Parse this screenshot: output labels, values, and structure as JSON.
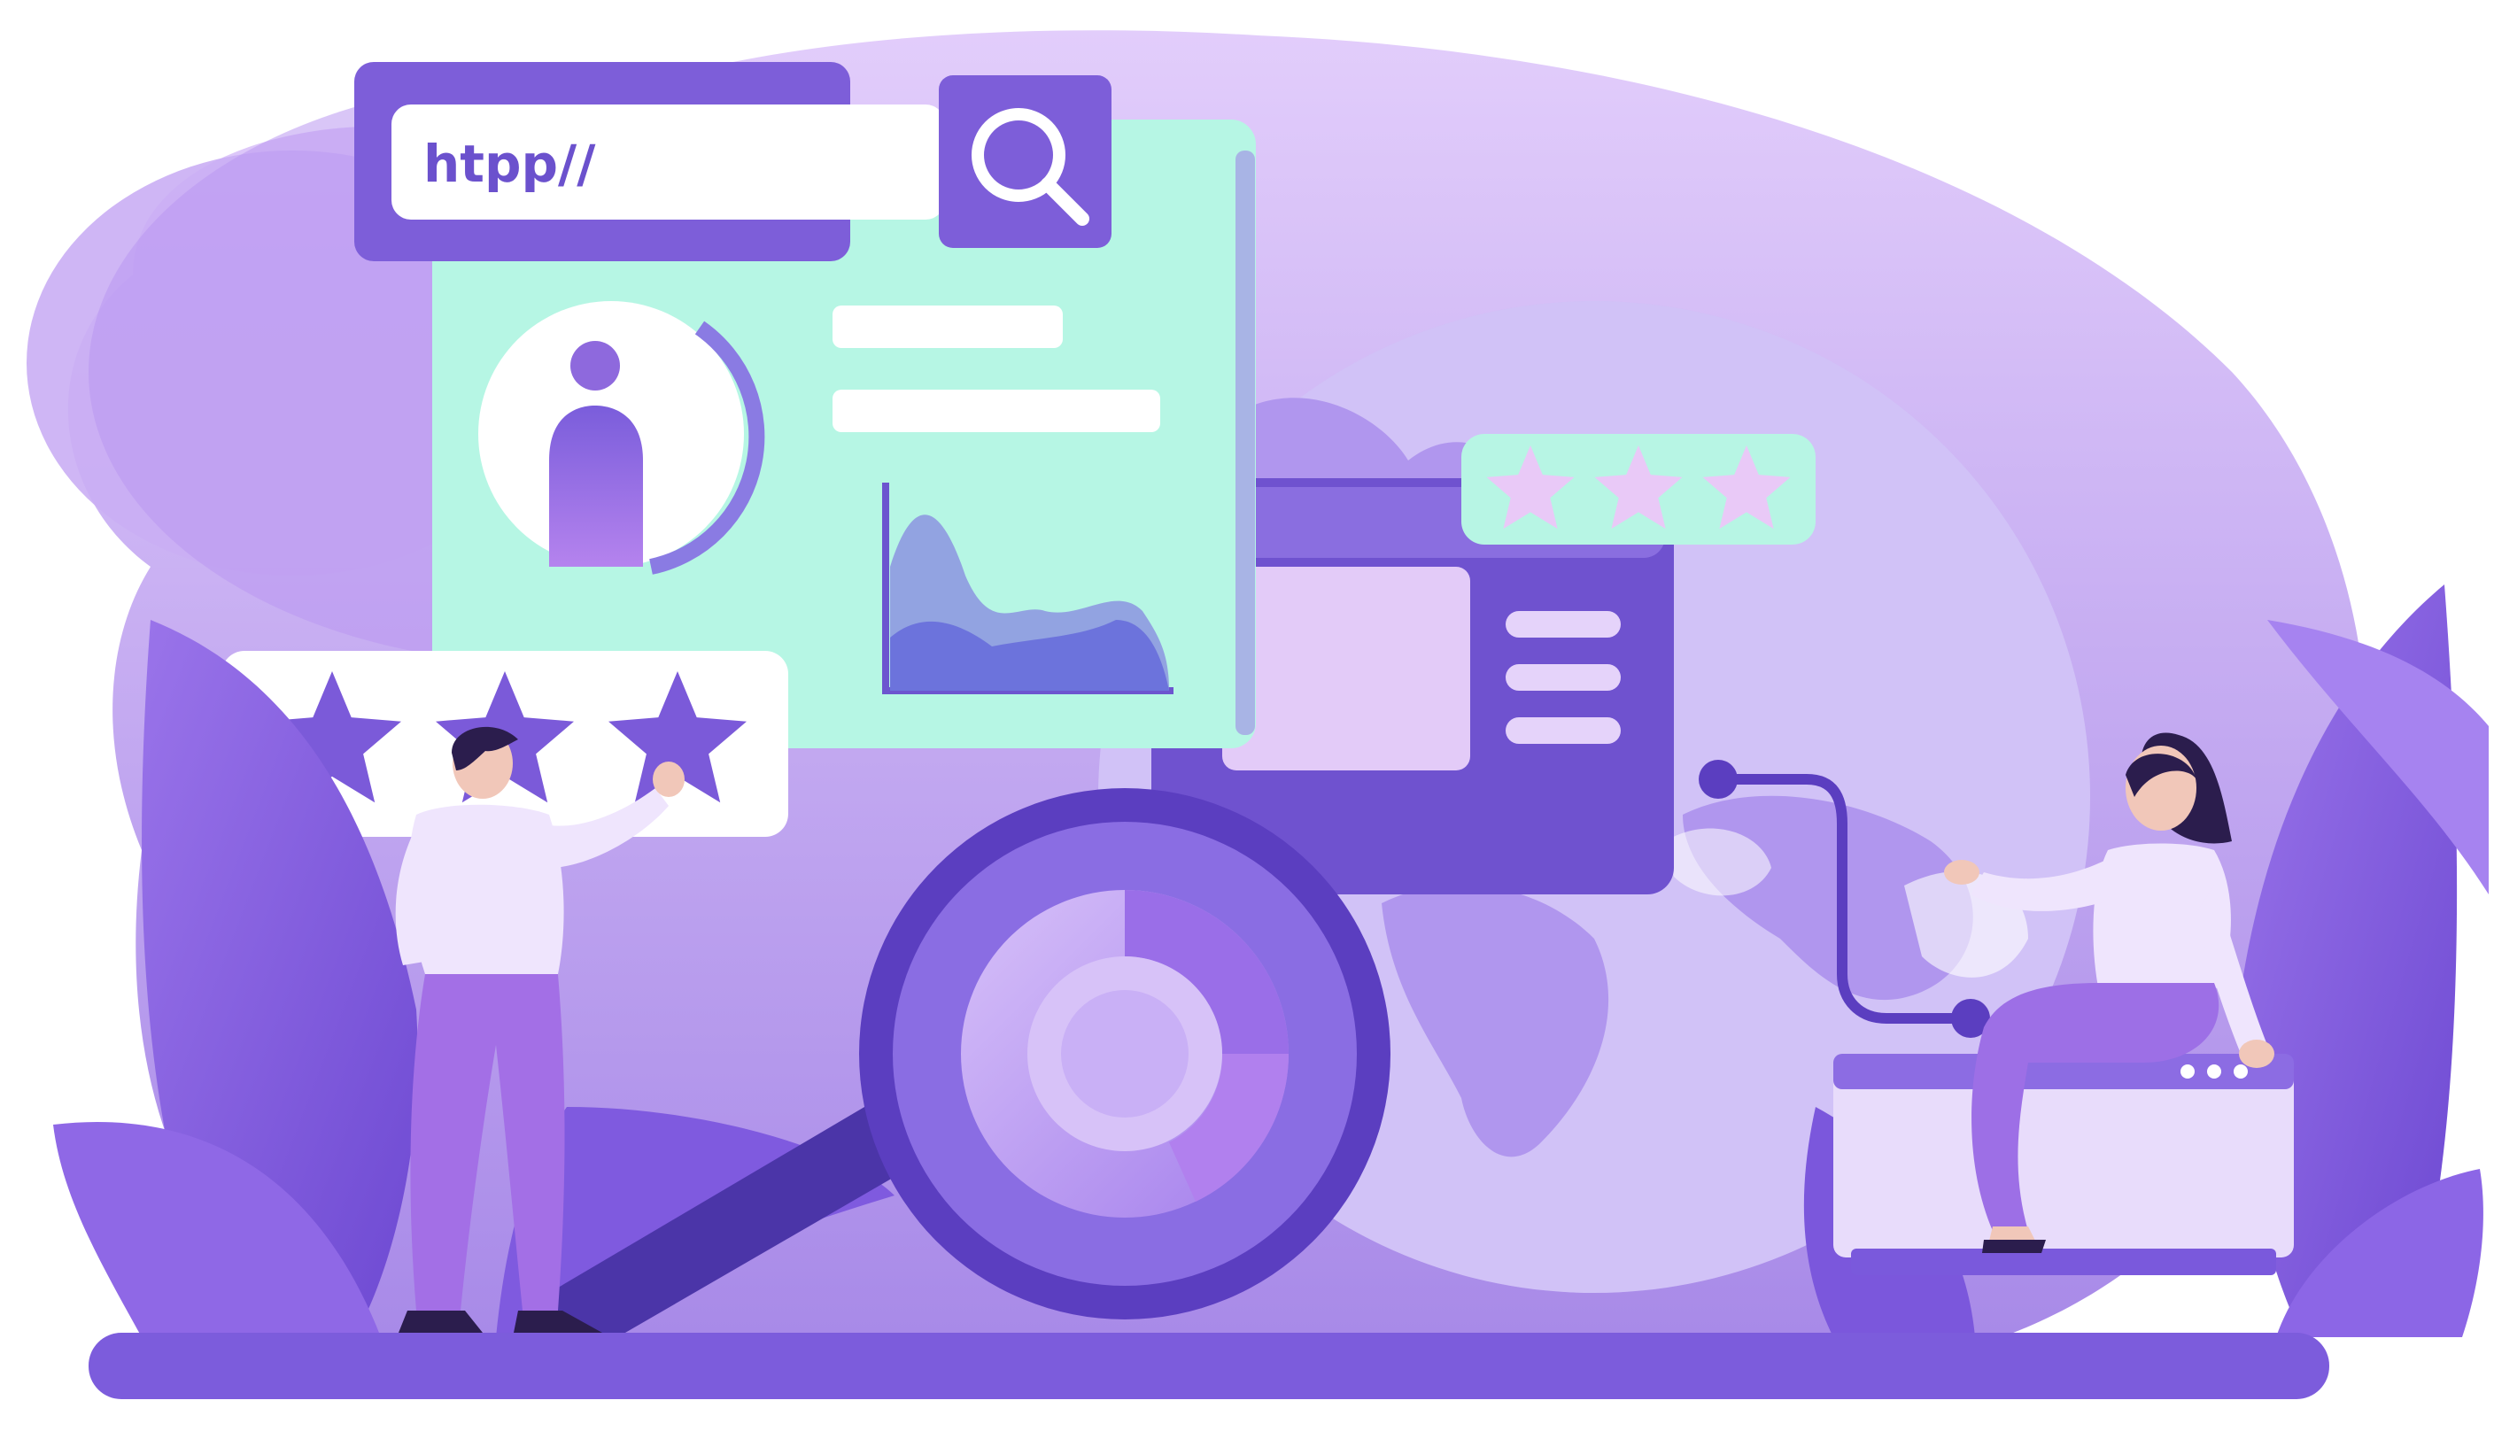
{
  "search_bar": {
    "url_text": "htpp//",
    "icon": "search-icon"
  },
  "profile_card": {
    "avatar_icon": "user-avatar-icon",
    "chart_icon": "area-chart-icon"
  },
  "ratings": {
    "left_panel_stars": 3,
    "right_panel_stars": 3
  },
  "colors": {
    "primary_purple": "#7b5ad9",
    "dark_purple": "#5a3fb8",
    "light_lavender": "#e4d3fb",
    "mint": "#b6f7e6",
    "accent_violet": "#a77bec"
  }
}
